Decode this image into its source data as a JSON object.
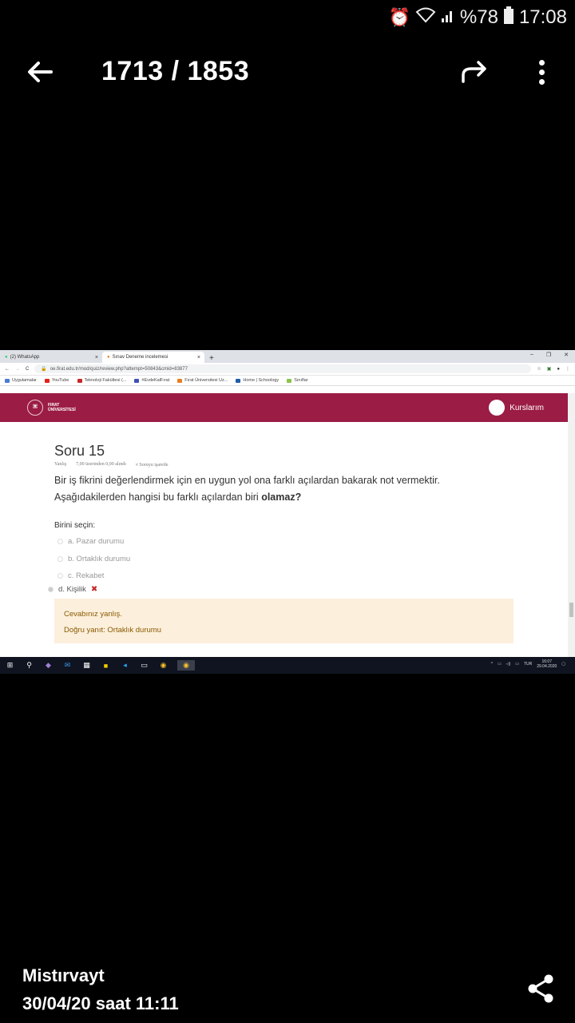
{
  "status": {
    "battery": "%78",
    "time": "17:08",
    "icons": [
      "alarm-icon",
      "wifi-icon",
      "signal-icon",
      "battery-icon"
    ]
  },
  "viewer": {
    "counter": "1713 / 1853",
    "caption_name": "Mistırvayt",
    "caption_date": "30/04/20 saat 11:11"
  },
  "browser": {
    "tabs": [
      {
        "label": "(2) WhatsApp"
      },
      {
        "label": "Sınav Deneme incelemesi"
      }
    ],
    "url": "oe.firat.edu.tr/mod/quiz/review.php?attempt=50843&cmid=83877",
    "bookmarks": [
      {
        "label": "Uygulamalar",
        "color": "#4a7bd6"
      },
      {
        "label": "YouTube",
        "color": "#e62117"
      },
      {
        "label": "Teknoloji Fakültesi (...",
        "color": "#c62828"
      },
      {
        "label": "#EvdeKalFırat",
        "color": "#3f51b5"
      },
      {
        "label": "Fırat Üniversitesi Uz...",
        "color": "#e67e22"
      },
      {
        "label": "Home | Schoology",
        "color": "#1e5ea8"
      },
      {
        "label": "Sınıflar",
        "color": "#8bc34a"
      }
    ]
  },
  "site": {
    "logo_line1": "FIRAT",
    "logo_line2": "ÜNİVERSİTESİ",
    "courses": "Kurslarım",
    "brand_color": "#9b1c45"
  },
  "question": {
    "title": "Soru 15",
    "status": "Yanlış",
    "score": "7,00 üzerinden 0,00 alındı",
    "flag": "Soruyu işaretle",
    "text_line1": "Bir iş fikrini değerlendirmek için en uygun yol ona farklı açılardan bakarak not vermektir.",
    "text_line2_prefix": "Aşağıdakilerden hangisi bu farklı açılardan biri ",
    "text_line2_bold": "olamaz?",
    "prompt": "Birini seçin:",
    "options": [
      {
        "label": "a. Pazar durumu"
      },
      {
        "label": "b. Ortaklık durumu"
      },
      {
        "label": "c. Rekabet"
      },
      {
        "label": "d. Kişilik"
      }
    ],
    "feedback_wrong": "Cevabınız yanlış.",
    "feedback_correct": "Doğru yanıt: Ortaklık durumu"
  },
  "taskbar": {
    "lang": "TUR",
    "clock_time": "16:07",
    "clock_date": "29.04.2020"
  }
}
